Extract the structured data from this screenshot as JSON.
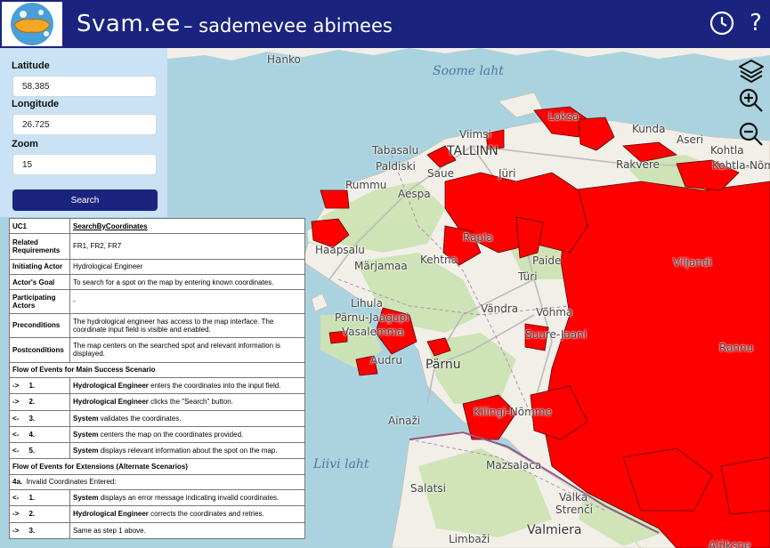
{
  "header": {
    "title": "Svam.ee",
    "subtitle": "– sademevee abimees",
    "help_glyph": "?"
  },
  "sidebar": {
    "latitude_label": "Latitude",
    "latitude_value": "58.385",
    "longitude_label": "Longitude",
    "longitude_value": "26.725",
    "zoom_label": "Zoom",
    "zoom_value": "15",
    "search_label": "Search"
  },
  "map": {
    "seas": [
      "Soome laht",
      "Liivi laht"
    ],
    "places": [
      "Hanko",
      "Viimsi",
      "Loksa",
      "Kunda",
      "Aseri",
      "Kohtla",
      "Kohtla-Nõmm",
      "Tabasalu",
      "TALLINN",
      "Paldiski",
      "Saue",
      "Rakvere",
      "Aespa",
      "Rummu",
      "Rapla",
      "Haapsalu",
      "Märjamaa",
      "Kehtna",
      "Paide",
      "Türi",
      "Lihula",
      "Vändra",
      "Võhma",
      "Pärnu-Jaagupi",
      "Vasalemma",
      "Suure-Jaani",
      "Audru",
      "Pärnu",
      "Kilingi-Nõmme",
      "Mazsalaca",
      "Salatsi",
      "Valka",
      "Strenči",
      "Limbaži",
      "Valmiera",
      "Alūksne",
      "Ainaži",
      "Viljandi",
      "Jüri",
      "Rannu"
    ],
    "colors": {
      "sea": "#aad3df",
      "land": "#f2efe9",
      "forest": "#cde3b4",
      "flood": "#ff0000",
      "border": "#8a5a8a"
    },
    "controls": [
      "layers-icon",
      "zoom-in-icon",
      "zoom-out-icon"
    ]
  },
  "use_case": {
    "id": "UC1",
    "name": "SearchByCoordinates",
    "related_label": "Related Requirements",
    "related_value": "FR1, FR2, FR7",
    "actor_label": "Initiating Actor",
    "actor_value": "Hydrological Engineer",
    "goal_label": "Actor's Goal",
    "goal_value": "To search for a spot on the map by entering known coordinates.",
    "participating_label": "Participating Actors",
    "participating_value": "-",
    "pre_label": "Preconditions",
    "pre_value": "The hydrological engineer has access to the map interface. The coordinate input field is visible and enabled.",
    "post_label": "Postconditions",
    "post_value": "The map centers on the searched spot and relevant information is displayed.",
    "main_flow_title": "Flow of Events for Main Success Scenario",
    "main_flow": [
      {
        "dir": "->",
        "num": "1.",
        "actor": "Hydrological Engineer",
        "text": " enters the coordinates into the input field."
      },
      {
        "dir": "->",
        "num": "2.",
        "actor": "Hydrological Engineer",
        "text": " clicks the \"Search\" button."
      },
      {
        "dir": "<-",
        "num": "3.",
        "actor": "System",
        "text": " validates the coordinates."
      },
      {
        "dir": "<-",
        "num": "4.",
        "actor": "System",
        "text": " centers the map on the coordinates provided."
      },
      {
        "dir": "<-",
        "num": "5.",
        "actor": "System",
        "text": " displays relevant information about the spot on the map."
      }
    ],
    "ext_flow_title": "Flow of Events for Extensions (Alternate Scenarios)",
    "ext_num": "4a.",
    "ext_text": "Invalid Coordinates Entered:",
    "ext_flow": [
      {
        "dir": "<-",
        "num": "1.",
        "actor": "System",
        "text": " displays an error message indicating invalid coordinates."
      },
      {
        "dir": "->",
        "num": "2.",
        "actor": "Hydrological Engineer",
        "text": " corrects the coordinates and retries."
      },
      {
        "dir": "->",
        "num": "3.",
        "actor": "",
        "text": "Same as step 1 above."
      }
    ]
  }
}
